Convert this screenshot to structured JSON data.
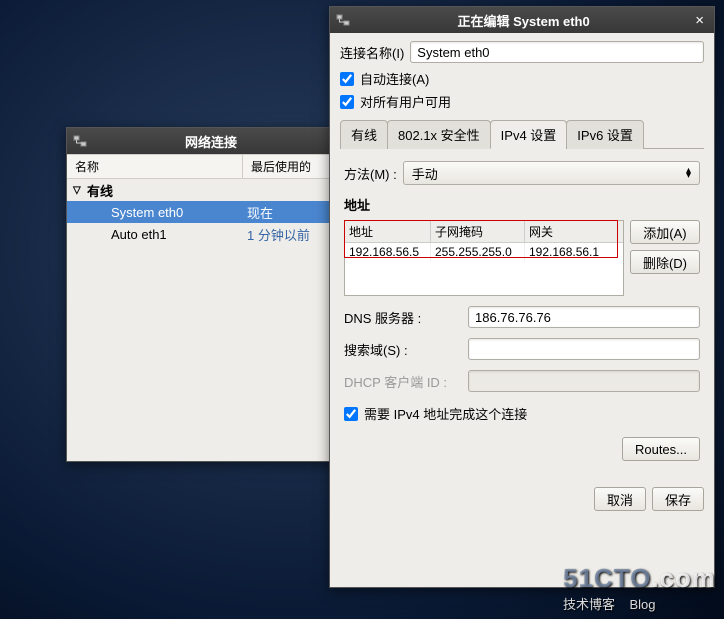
{
  "nc_window": {
    "title": "网络连接",
    "columns": {
      "name": "名称",
      "last_used": "最后使用的"
    },
    "wired_category": "有线",
    "items": [
      {
        "name": "System eth0",
        "last_used": "现在",
        "selected": true
      },
      {
        "name": "Auto eth1",
        "last_used": "1 分钟以前",
        "selected": false
      }
    ]
  },
  "edit_window": {
    "title": "正在编辑  System eth0",
    "conn_name_label": "连接名称(I)",
    "conn_name_value": "System eth0",
    "auto_connect": "自动连接(A)",
    "avail_all": "对所有用户可用",
    "tabs": {
      "wired": "有线",
      "security": "802.1x 安全性",
      "ipv4": "IPv4 设置",
      "ipv6": "IPv6 设置"
    },
    "active_tab": "ipv4",
    "method_label": "方法(M) :",
    "method_value": "手动",
    "addr_section": "地址",
    "addr_cols": {
      "address": "地址",
      "netmask": "子网掩码",
      "gateway": "网关"
    },
    "btn_add": "添加(A)",
    "btn_delete": "删除(D)",
    "dns_label": "DNS 服务器 :",
    "dns_value": "186.76.76.76",
    "search_label": "搜索域(S) :",
    "search_value": "",
    "dhcp_label": "DHCP 客户端 ID :",
    "dhcp_value": "",
    "require_ipv4": "需要 IPv4 地址完成这个连接",
    "routes": "Routes...",
    "cancel": "取消",
    "save": "保存"
  },
  "chart_data": {
    "type": "table",
    "title": "地址",
    "columns": [
      "地址",
      "子网掩码",
      "网关"
    ],
    "rows": [
      [
        "192.168.56.5",
        "255.255.255.0",
        "192.168.56.1"
      ]
    ]
  },
  "watermark": {
    "site": "51CTO.com",
    "sub1": "技术博客",
    "sub2": "Blog"
  }
}
